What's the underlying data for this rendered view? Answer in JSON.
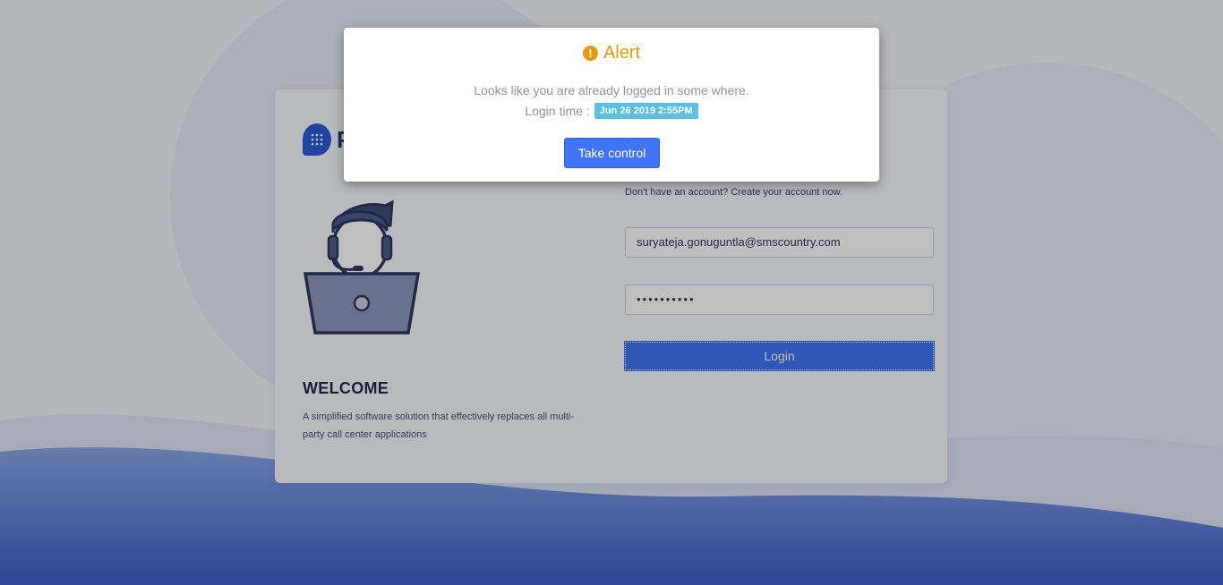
{
  "modal": {
    "title": "Alert",
    "message": "Looks like you are already logged in some where.",
    "login_time_label": "Login time :",
    "login_time_value": "Jun 26 2019 2:55PM",
    "take_control_label": "Take control"
  },
  "brand": {
    "logo_letter": "P"
  },
  "welcome": {
    "title": "WELCOME",
    "description": "A simplified software solution that effectively replaces all multi-party call center applications"
  },
  "login_form": {
    "signup_text": "Don't have an account? Create your account now.",
    "email_value": "suryateja.gonuguntla@smscountry.com",
    "password_value": "••••••••••",
    "login_label": "Login"
  },
  "colors": {
    "primary": "#3e74f5",
    "alert": "#e39a0f",
    "badge": "#5bbfe0",
    "brand": "#2a5bd7"
  }
}
